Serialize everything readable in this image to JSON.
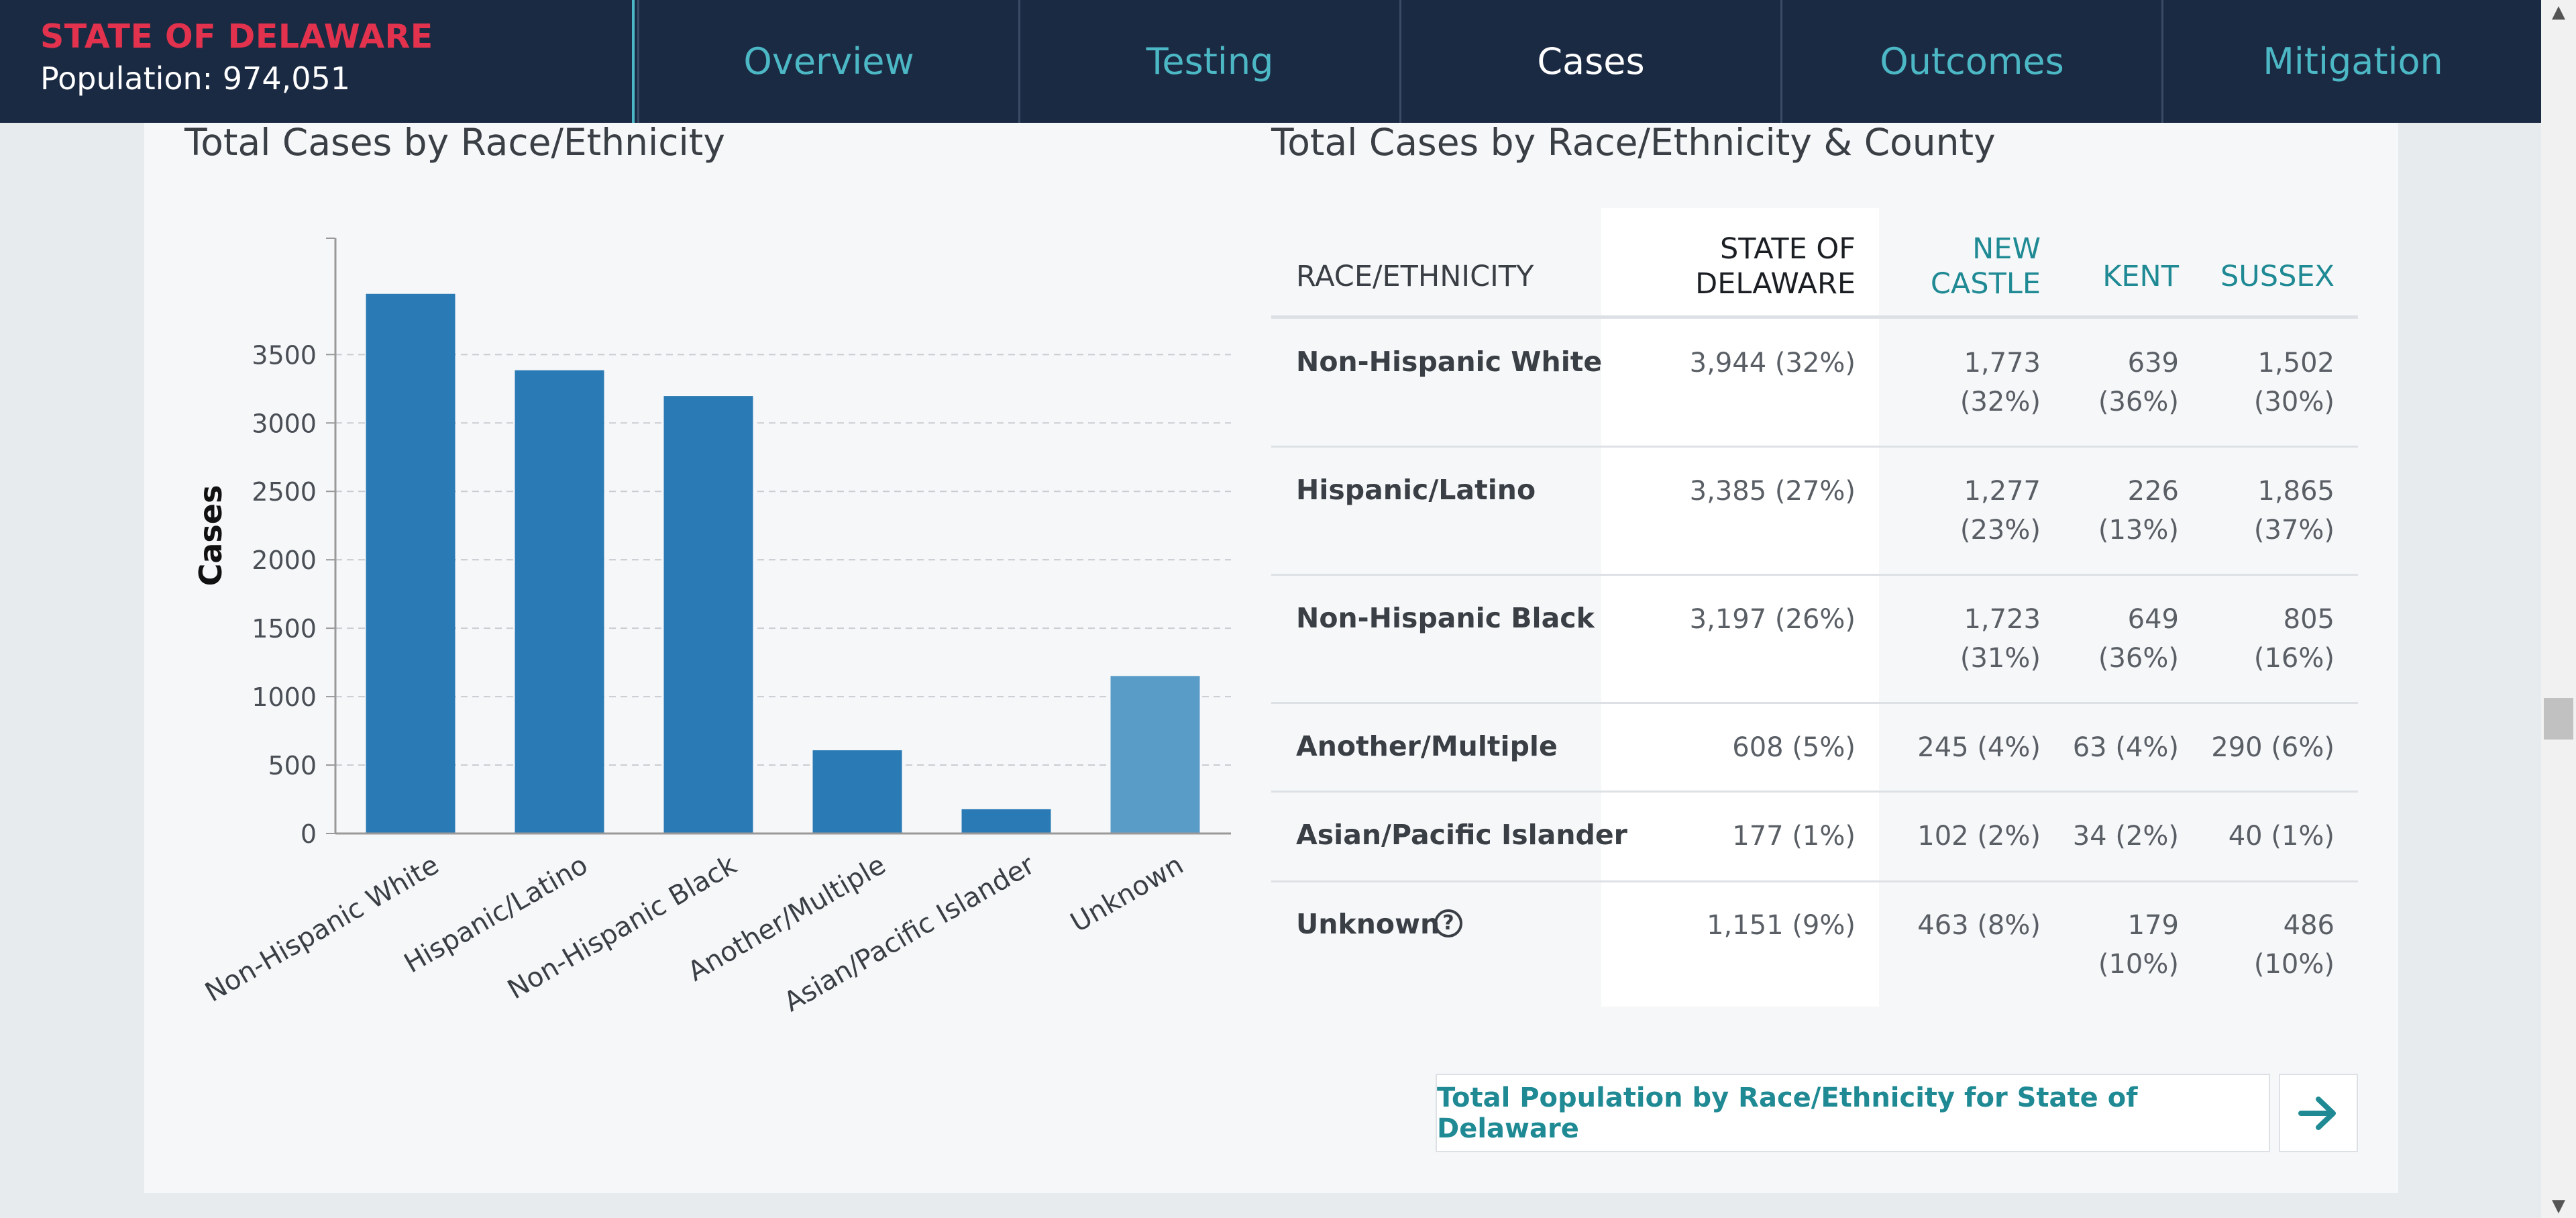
{
  "header": {
    "title": "STATE OF DELAWARE",
    "population": "Population: 974,051",
    "tabs": [
      {
        "label": "Overview",
        "active": false
      },
      {
        "label": "Testing",
        "active": false
      },
      {
        "label": "Cases",
        "active": true
      },
      {
        "label": "Outcomes",
        "active": false
      },
      {
        "label": "Mitigation",
        "active": false
      }
    ]
  },
  "colors": {
    "nav_bg": "#1b2a43",
    "brand_red": "#e2324d",
    "teal": "#4cb8c5",
    "bar": "#2a7ab5",
    "bar_unknown": "#5a9cc8"
  },
  "chart_section": {
    "title": "Total Cases by Race/Ethnicity"
  },
  "chart_data": {
    "type": "bar",
    "ylabel": "Cases",
    "xlabel": "",
    "categories": [
      "Non-Hispanic White",
      "Hispanic/Latino",
      "Non-Hispanic Black",
      "Another/Multiple",
      "Asian/Pacific Islander",
      "Unknown"
    ],
    "values": [
      3944,
      3385,
      3197,
      608,
      177,
      1151
    ],
    "yticks": [
      0,
      500,
      1000,
      1500,
      2000,
      2500,
      3000,
      3500
    ],
    "ylim": [
      0,
      4350
    ],
    "grid": true
  },
  "table_section": {
    "title": "Total Cases by Race/Ethnicity & County",
    "headers": {
      "race": "RACE/ETHNICITY",
      "state_l1": "STATE OF",
      "state_l2": "DELAWARE",
      "nc_l1": "NEW",
      "nc_l2": "CASTLE",
      "kent": "KENT",
      "sussex": "SUSSEX"
    },
    "rows": [
      {
        "label": "Non-Hispanic White",
        "state": "3,944 (32%)",
        "nc_a": "1,773",
        "nc_b": "(32%)",
        "kent_a": "639",
        "kent_b": "(36%)",
        "sus_a": "1,502",
        "sus_b": "(30%)"
      },
      {
        "label": "Hispanic/Latino",
        "state": "3,385 (27%)",
        "nc_a": "1,277",
        "nc_b": "(23%)",
        "kent_a": "226",
        "kent_b": "(13%)",
        "sus_a": "1,865",
        "sus_b": "(37%)"
      },
      {
        "label": "Non-Hispanic Black",
        "state": "3,197 (26%)",
        "nc_a": "1,723",
        "nc_b": "(31%)",
        "kent_a": "649",
        "kent_b": "(36%)",
        "sus_a": "805",
        "sus_b": "(16%)"
      },
      {
        "label": "Another/Multiple",
        "state": "608 (5%)",
        "nc_a": "245 (4%)",
        "kent_a": "63 (4%)",
        "sus_a": "290 (6%)"
      },
      {
        "label": "Asian/Pacific Islander",
        "state": "177 (1%)",
        "nc_a": "102 (2%)",
        "kent_a": "34 (2%)",
        "sus_a": "40 (1%)"
      },
      {
        "label": "Unknown",
        "state": "1,151 (9%)",
        "nc_a": "463 (8%)",
        "kent_a": "179",
        "kent_b": "(10%)",
        "sus_a": "486",
        "sus_b": "(10%)"
      }
    ],
    "help_glyph": "?",
    "population_button": "Total Population by Race/Ethnicity for State of Delaware",
    "arrow_icon": "arrow-right-icon"
  },
  "scrollbar": {
    "up": "▲",
    "down": "▼"
  }
}
